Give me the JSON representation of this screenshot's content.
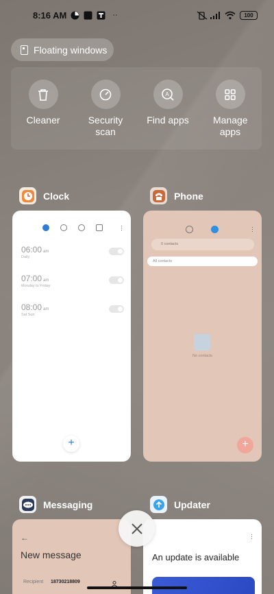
{
  "status_bar": {
    "time": "8:16 AM",
    "battery": "100"
  },
  "floating_windows": {
    "label": "Floating windows"
  },
  "tools": [
    {
      "id": "cleaner",
      "label": "Cleaner",
      "icon": "trash-icon"
    },
    {
      "id": "security",
      "label": "Security scan",
      "icon": "security-scan-icon"
    },
    {
      "id": "find",
      "label": "Find apps",
      "icon": "find-apps-icon"
    },
    {
      "id": "manage",
      "label": "Manage apps",
      "icon": "grid-icon"
    }
  ],
  "apps": {
    "clock": {
      "name": "Clock",
      "alarms": [
        {
          "time": "06:00",
          "ampm": "am",
          "repeat": "Daily",
          "enabled": false
        },
        {
          "time": "07:00",
          "ampm": "am",
          "repeat": "Monday to Friday",
          "enabled": false
        },
        {
          "time": "08:00",
          "ampm": "am",
          "repeat": "Sat Sun",
          "enabled": false
        }
      ]
    },
    "phone": {
      "name": "Phone",
      "search_placeholder": "0 contacts",
      "filter": "All contacts",
      "empty_text": "No contacts"
    },
    "messaging": {
      "name": "Messaging",
      "title": "New message",
      "recipient_label": "Recipient",
      "recipient_value": "18730218809"
    },
    "updater": {
      "name": "Updater",
      "title": "An update is available"
    }
  },
  "colors": {
    "accent_blue": "#2f7bd6",
    "phone_card_bg": "#e2c6b7",
    "phone_fab": "#f0a69a"
  }
}
